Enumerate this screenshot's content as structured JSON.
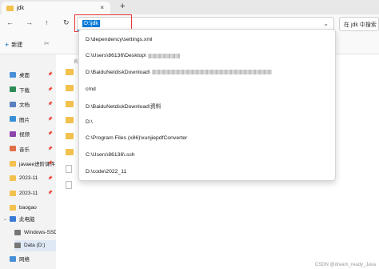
{
  "tab": {
    "title": "jdk",
    "close": "×",
    "new": "+"
  },
  "nav": {
    "back": "←",
    "forward": "→",
    "up": "↑",
    "refresh": "↻"
  },
  "address": {
    "value": "D:\\jdk",
    "chevron": "⌄"
  },
  "search": {
    "placeholder": "在 jdk 中搜索"
  },
  "toolbar": {
    "new_label": "新建",
    "new_icon": "+",
    "cut_icon": "✂"
  },
  "sidebar": {
    "items": [
      {
        "label": "桌面",
        "icon": "desktop-icon",
        "color": "#4a90d9",
        "pinned": true
      },
      {
        "label": "下载",
        "icon": "download-icon",
        "color": "#2e8b57",
        "pinned": true
      },
      {
        "label": "文档",
        "icon": "documents-icon",
        "color": "#5b7fbf",
        "pinned": true
      },
      {
        "label": "图片",
        "icon": "pictures-icon",
        "color": "#3a8fd6",
        "pinned": true
      },
      {
        "label": "视频",
        "icon": "videos-icon",
        "color": "#8e44ad",
        "pinned": true
      },
      {
        "label": "音乐",
        "icon": "music-icon",
        "color": "#e0704a",
        "pinned": true
      },
      {
        "label": "javaee进阶课件",
        "icon": "folder-icon",
        "color": "#f2c14e",
        "pinned": true
      },
      {
        "label": "2023-11",
        "icon": "folder-icon",
        "color": "#f2c14e",
        "pinned": true
      },
      {
        "label": "2023-11",
        "icon": "folder-icon",
        "color": "#f2c14e",
        "pinned": true
      },
      {
        "label": "baogao",
        "icon": "folder-icon",
        "color": "#f2c14e",
        "pinned": false
      }
    ],
    "this_pc": "此电脑",
    "drives": [
      {
        "label": "Windows-SSD"
      },
      {
        "label": "Data (D:)"
      },
      {
        "label": "网络"
      }
    ]
  },
  "dropdown": {
    "items": [
      {
        "text": "D:\\dependency\\settings.xml",
        "blur": 0
      },
      {
        "text": "C:\\Users\\86136\\Desktop\\",
        "blur": 40
      },
      {
        "text": "D:\\BaiduNetdiskDownload\\",
        "blur": 150
      },
      {
        "text": "cmd",
        "blur": 0
      },
      {
        "text": "D:\\BaiduNetdiskDownload\\资料",
        "blur": 0
      },
      {
        "text": "D:\\",
        "blur": 0
      },
      {
        "text": "C:\\Program Files (x86)\\xunjiepdfConverter",
        "blur": 0
      },
      {
        "text": "C:\\Users\\86136\\.ssh",
        "blur": 0
      },
      {
        "text": "D:\\code\\2022_11",
        "blur": 0
      }
    ]
  },
  "watermark": "CSDN @dream_ready_Java"
}
